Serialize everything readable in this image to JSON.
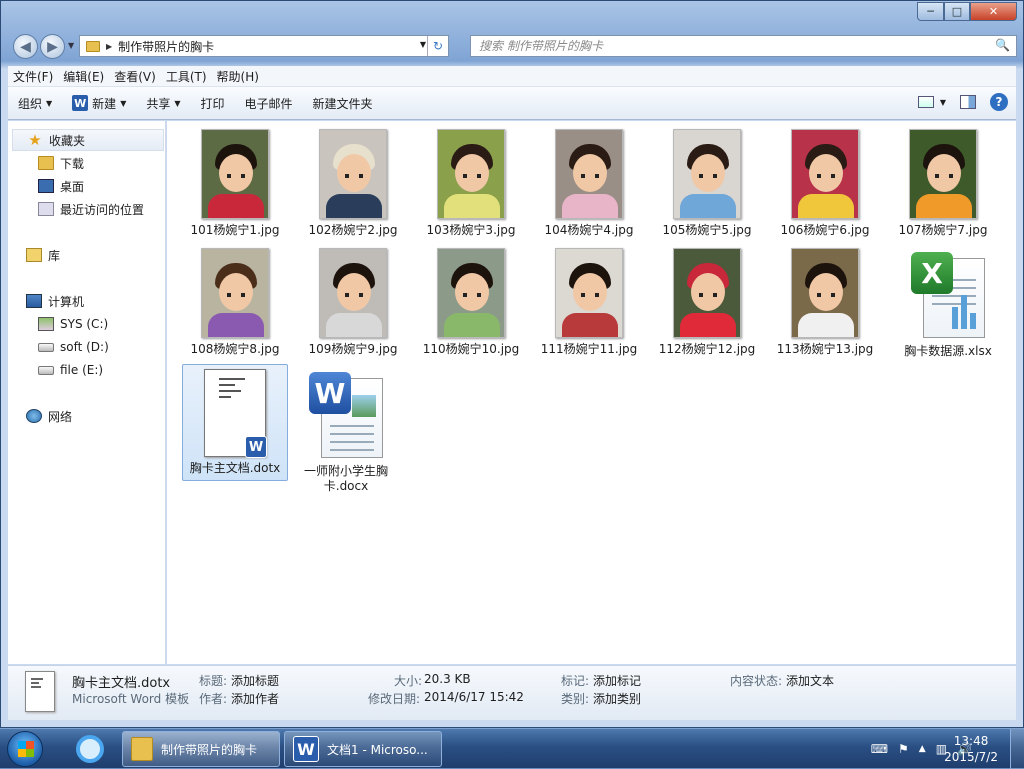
{
  "window": {
    "min_label": "─",
    "max_label": "□",
    "close_label": "✕"
  },
  "nav": {
    "back": "◀",
    "forward": "▶",
    "history_caret": "▼",
    "breadcrumb_sep": "▶",
    "address": "制作带照片的胸卡",
    "address_caret": "▼",
    "refresh": "↻",
    "search_placeholder": "搜索 制作带照片的胸卡",
    "search_icon": "🔍"
  },
  "menu": [
    "文件(F)",
    "编辑(E)",
    "查看(V)",
    "工具(T)",
    "帮助(H)"
  ],
  "toolbar": {
    "organize": "组织",
    "new": "新建",
    "share": "共享",
    "print": "打印",
    "email": "电子邮件",
    "new_folder": "新建文件夹",
    "caret": "▼",
    "help": "?",
    "word_letter": "W"
  },
  "sidebar": {
    "favorites": "收藏夹",
    "downloads": "下载",
    "desktop": "桌面",
    "recent": "最近访问的位置",
    "libraries": "库",
    "computer": "计算机",
    "drive_c": "SYS (C:)",
    "drive_d": "soft (D:)",
    "drive_e": "file (E:)",
    "network": "网络"
  },
  "files": [
    {
      "name": "101杨婉宁1.jpg",
      "bg": "#5d6b44",
      "shirt": "#c8283a",
      "hair": "#1d130d"
    },
    {
      "name": "102杨婉宁2.jpg",
      "bg": "#c9c4be",
      "shirt": "#2a3e5c",
      "hair": "#e7e0cc"
    },
    {
      "name": "103杨婉宁3.jpg",
      "bg": "#8aa04a",
      "shirt": "#e2e07a",
      "hair": "#2a1c14"
    },
    {
      "name": "104杨婉宁4.jpg",
      "bg": "#9a8f86",
      "shirt": "#e8b4c8",
      "hair": "#2a1c14"
    },
    {
      "name": "105杨婉宁5.jpg",
      "bg": "#d9d5d0",
      "shirt": "#6fa7d8",
      "hair": "#2a1c14"
    },
    {
      "name": "106杨婉宁6.jpg",
      "bg": "#b8324a",
      "shirt": "#f0c63a",
      "hair": "#2a1c14"
    },
    {
      "name": "107杨婉宁7.jpg",
      "bg": "#3f5a2a",
      "shirt": "#f09a2a",
      "hair": "#1d130d"
    },
    {
      "name": "108杨婉宁8.jpg",
      "bg": "#b8b4a0",
      "shirt": "#8a5ab0",
      "hair": "#4a2e1a"
    },
    {
      "name": "109杨婉宁9.jpg",
      "bg": "#bfbcb8",
      "shirt": "#d8d8d8",
      "hair": "#1d130d"
    },
    {
      "name": "110杨婉宁10.jpg",
      "bg": "#8c9a8a",
      "shirt": "#8ab86a",
      "hair": "#1d130d"
    },
    {
      "name": "111杨婉宁11.jpg",
      "bg": "#dcd8d2",
      "shirt": "#b83a3a",
      "hair": "#1d130d"
    },
    {
      "name": "112杨婉宁12.jpg",
      "bg": "#4a5a3a",
      "shirt": "#e02a3a",
      "hair": "#c8283a"
    },
    {
      "name": "113杨婉宁13.jpg",
      "bg": "#7a6a4a",
      "shirt": "#f0f0f0",
      "hair": "#1d130d"
    }
  ],
  "excel": {
    "name": "胸卡数据源.xlsx",
    "letter": "X"
  },
  "dotx": {
    "name": "胸卡主文档.dotx",
    "letter": "W"
  },
  "docx": {
    "name_line1": "一师附小学生胸",
    "name_line2": "卡.docx",
    "letter": "W"
  },
  "details": {
    "filename": "胸卡主文档.dotx",
    "filetype": "Microsoft Word 模板",
    "title_label": "标题:",
    "title_value": "添加标题",
    "author_label": "作者:",
    "author_value": "添加作者",
    "size_label": "大小:",
    "size_value": "20.3 KB",
    "modified_label": "修改日期:",
    "modified_value": "2014/6/17 15:42",
    "tags_label": "标记:",
    "tags_value": "添加标记",
    "category_label": "类别:",
    "category_value": "添加类别",
    "content_label": "内容状态:",
    "content_value": "添加文本"
  },
  "taskbar": {
    "explorer_task": "制作带照片的胸卡",
    "word_task": "文档1 - Microso...",
    "word_letter": "W",
    "time": "13:48",
    "date": "2015/7/2",
    "tray_keyboard": "⌨",
    "tray_flag": "⚑",
    "tray_up": "▲",
    "tray_net": "▥",
    "tray_vol": "🔊"
  }
}
